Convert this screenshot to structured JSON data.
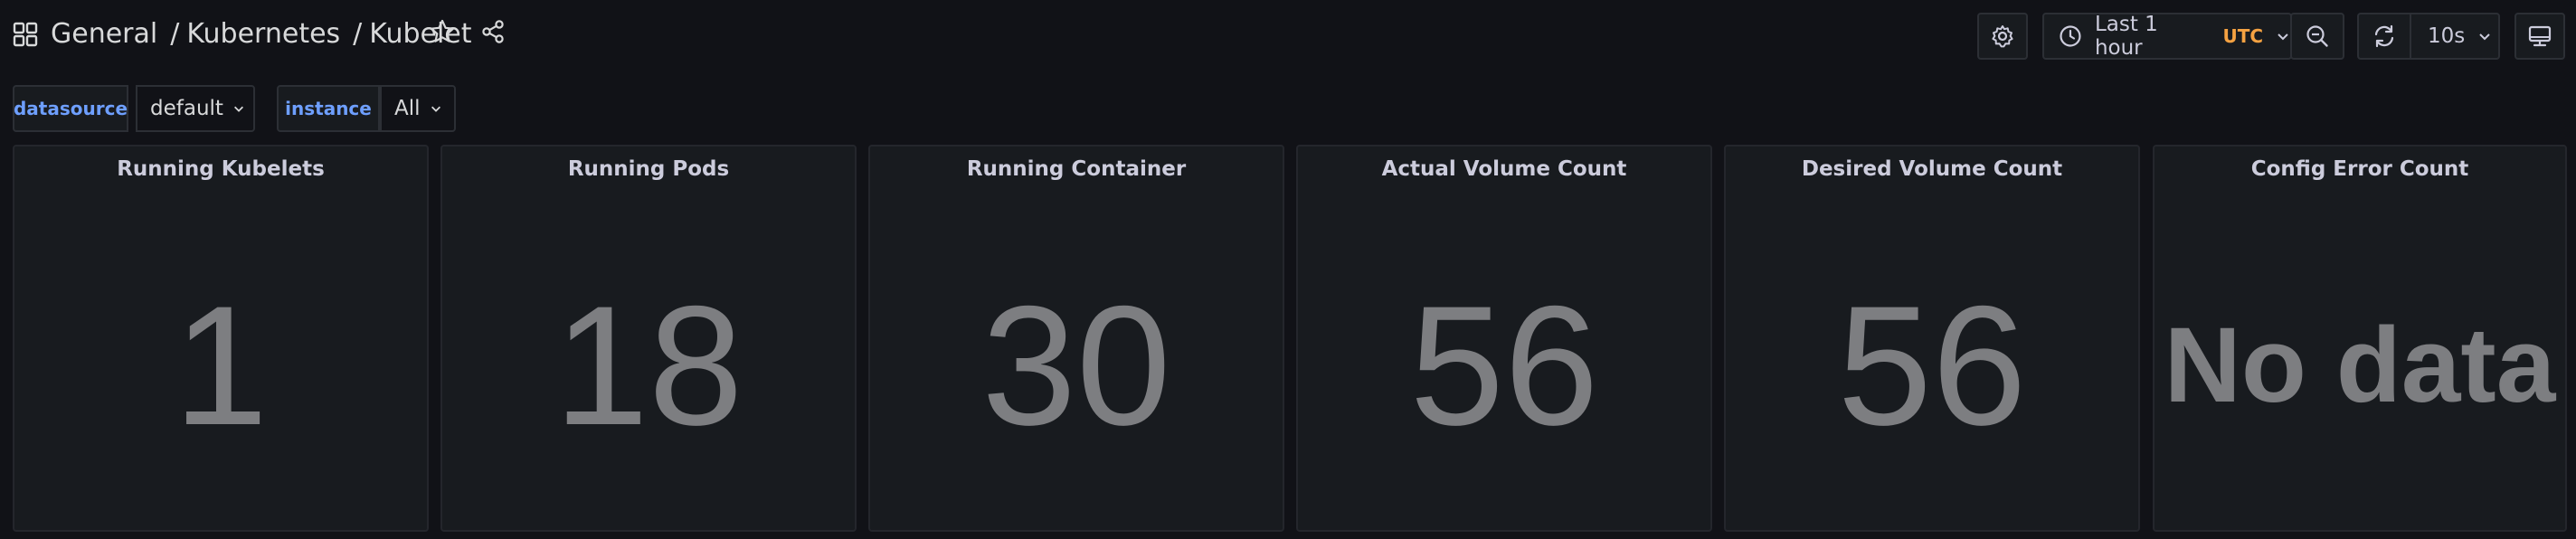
{
  "breadcrumb": {
    "folder": "General",
    "sep1": "/",
    "section": "Kubernetes",
    "sep2": "/",
    "dashboard": "Kubelet"
  },
  "toolbar": {
    "time_range": "Last 1 hour",
    "timezone": "UTC",
    "refresh_interval": "10s"
  },
  "variables": {
    "datasource": {
      "label": "datasource",
      "value": "default"
    },
    "instance": {
      "label": "instance",
      "value": "All"
    }
  },
  "panels": [
    {
      "title": "Running Kubelets",
      "value": "1"
    },
    {
      "title": "Running Pods",
      "value": "18"
    },
    {
      "title": "Running Container",
      "value": "30"
    },
    {
      "title": "Actual Volume Count",
      "value": "56"
    },
    {
      "title": "Desired Volume Count",
      "value": "56"
    },
    {
      "title": "Config Error Count",
      "value": "No data"
    }
  ],
  "colors": {
    "background": "#111217",
    "panel": "#181b1f",
    "variable_label": "#6e9fff",
    "timezone": "#f5a242",
    "stat_value": "#7d7e81"
  },
  "icons": [
    "apps-icon",
    "star-icon",
    "share-icon",
    "gear-icon",
    "clock-icon",
    "chevron-down-icon",
    "zoom-out-icon",
    "refresh-icon",
    "tv-icon"
  ]
}
